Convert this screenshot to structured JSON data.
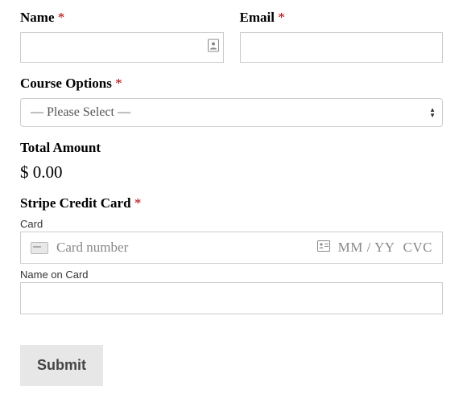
{
  "name": {
    "label": "Name",
    "required": "*",
    "value": ""
  },
  "email": {
    "label": "Email",
    "required": "*",
    "value": ""
  },
  "course": {
    "label": "Course Options",
    "required": "*",
    "selected": "— Please Select —"
  },
  "total": {
    "label": "Total Amount",
    "value": "$ 0.00"
  },
  "stripe": {
    "label": "Stripe Credit Card",
    "required": "*",
    "card_sublabel": "Card",
    "card_number_placeholder": "Card number",
    "mm_placeholder": "MM / YY",
    "cvc_placeholder": "CVC",
    "name_on_card_sublabel": "Name on Card",
    "name_on_card_value": ""
  },
  "submit": {
    "label": "Submit"
  }
}
